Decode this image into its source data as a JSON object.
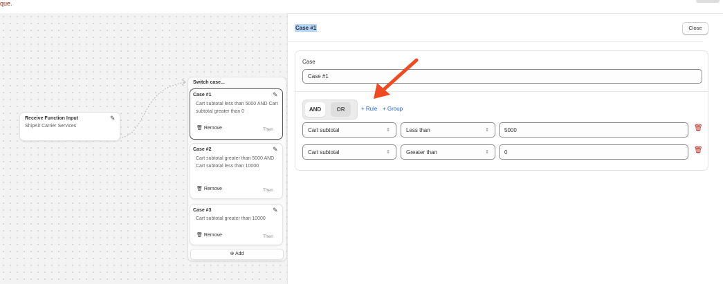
{
  "top_message": "que.",
  "canvas": {
    "receive_node": {
      "title": "Receive Function Input",
      "subtitle": "ShipKit Carrier Services"
    },
    "switch_node": {
      "title": "Switch case...",
      "add_label": "Add",
      "cases": [
        {
          "title": "Case #1",
          "description": "Cart subtotal less than 5000 AND Cart subtotal greater than 0",
          "remove_label": "Remove",
          "then_label": "Then"
        },
        {
          "title": "Case #2",
          "description": "Cart subtotal greater than 5000 AND Cart subtotal less than 10000",
          "remove_label": "Remove",
          "then_label": "Then"
        },
        {
          "title": "Case #3",
          "description": "Cart subtotal greater than 10000",
          "remove_label": "Remove",
          "then_label": "Then"
        }
      ]
    }
  },
  "panel": {
    "title": "Case #1",
    "close_label": "Close",
    "case_label": "Case",
    "case_value": "Case #1",
    "combinator": {
      "and_label": "AND",
      "or_label": "OR",
      "selected": "AND"
    },
    "add_rule_label": "+ Rule",
    "add_group_label": "+ Group",
    "rules": [
      {
        "field": "Cart subtotal",
        "operator": "Less than",
        "value": "5000"
      },
      {
        "field": "Cart subtotal",
        "operator": "Greater than",
        "value": "0"
      }
    ]
  },
  "annotation_color": "#f04a23"
}
